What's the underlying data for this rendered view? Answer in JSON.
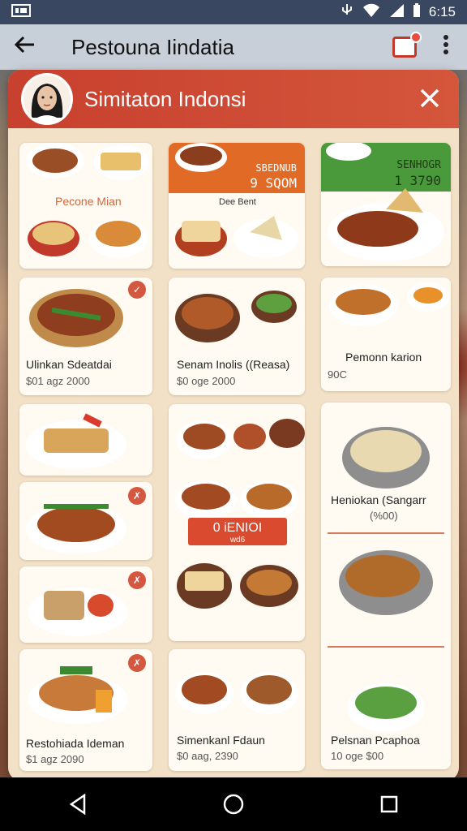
{
  "status_bar": {
    "time": "6:15"
  },
  "app_bar": {
    "title": "Pestouna Iindatia"
  },
  "dialog": {
    "title": "Simitaton Indonsi"
  },
  "cards": {
    "c1_label": "Pecone Mian",
    "c2_banner_1": "SBEDNUB",
    "c2_banner_2": "9 SQOM",
    "c2_label": "Dee Bent",
    "c3_banner_1": "SENHOGR",
    "c3_banner_2": "1 3790",
    "c4_title": "Ulinkan Sdeatdai",
    "c4_price": "$01 agz 2000",
    "c5_title": "Senam Inolis ((Reasa)",
    "c5_price": "$0 oge 2000",
    "c6_title": "Pemonn karion",
    "c6_price": "90C",
    "c8_banner_1": "0 iENIOI",
    "c8_banner_2": "wd6",
    "c9_title": "Heniokan (Sangarr",
    "c9_price": "(%00)",
    "c12_title": "Restohiada Ideman",
    "c12_price": "$1 agz 2090",
    "c13_title": "Simenkanl Fdaun",
    "c13_price": "$0 aag, 2390",
    "c14_title": "Pelsnan Pcaphoa",
    "c14_price": "10 oge $00"
  },
  "colors": {
    "header": "#c8402e",
    "dialog_bg": "#f2e1c6",
    "accent": "#d4583f"
  }
}
